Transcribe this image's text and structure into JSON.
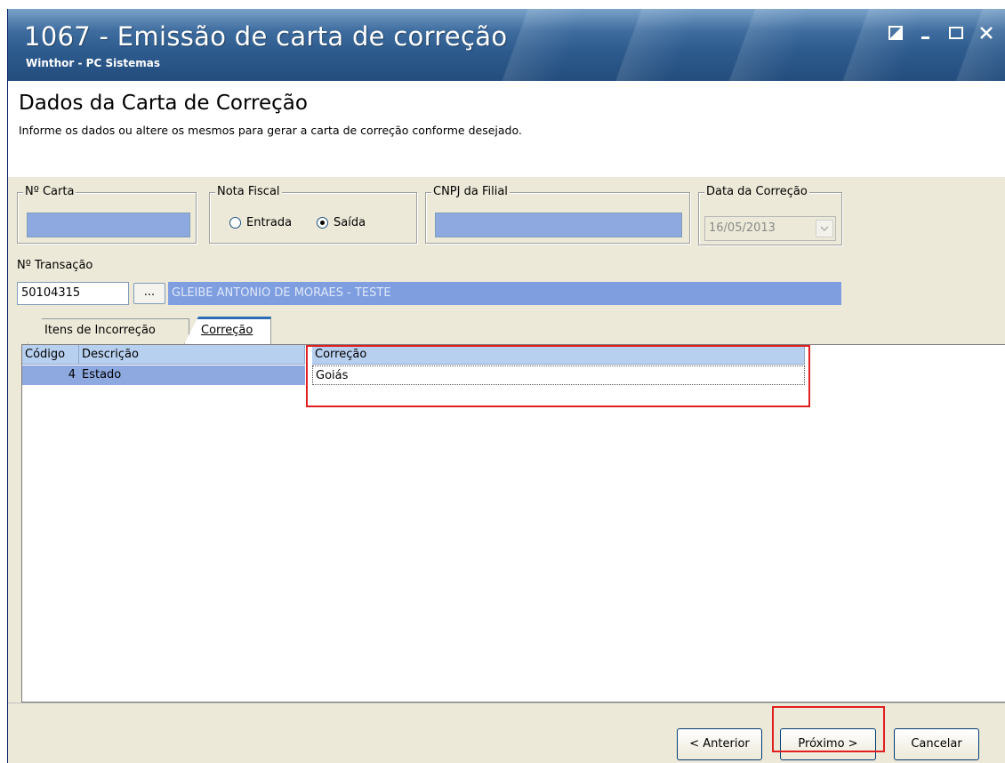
{
  "window": {
    "title": "1067 - Emissão de carta de correção",
    "subtitle": "Winthor - PC Sistemas"
  },
  "header": {
    "title": "Dados da Carta de Correção",
    "description": "Informe os dados ou altere os mesmos para gerar a carta de correção conforme desejado."
  },
  "form": {
    "num_carta_label": "Nº Carta",
    "num_carta_value": "",
    "nota_fiscal_label": "Nota Fiscal",
    "radio_entrada": "Entrada",
    "radio_saida": "Saída",
    "selected": "Saída",
    "cnpj_label": "CNPJ da Filial",
    "cnpj_value": "",
    "data_label": "Data da Correção",
    "data_value": "16/05/2013",
    "transacao_label": "Nº Transação",
    "transacao_value": "50104315",
    "ellipsis": "...",
    "client_name": "GLEIBE ANTONIO DE MORAES - TESTE"
  },
  "tabs": [
    {
      "label": "Itens de Incorreção",
      "active": false
    },
    {
      "label": "Correção",
      "active": true
    }
  ],
  "grid": {
    "columns": [
      "Código",
      "Descrição",
      "Correção"
    ],
    "rows": [
      {
        "codigo": "4",
        "descricao": "Estado",
        "correcao": "Goiás"
      }
    ]
  },
  "buttons": {
    "anterior": "< Anterior",
    "proximo": "Próximo >",
    "cancelar": "Cancelar"
  },
  "colors": {
    "highlight": "#e02020",
    "field_fill": "#8ea9e0",
    "title_bar": "#2d5a8d"
  }
}
